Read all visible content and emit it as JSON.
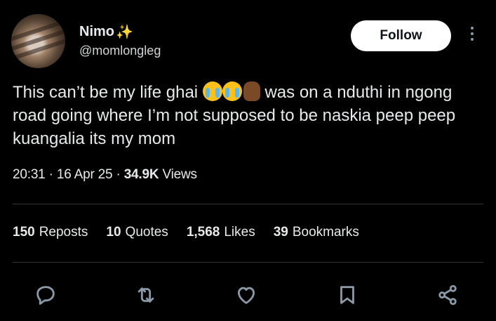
{
  "author": {
    "name": "Nimo",
    "name_emoji": "✨",
    "handle": "@momlongleg"
  },
  "header": {
    "follow_label": "Follow",
    "more_icon": "more-vertical-icon"
  },
  "tweet": {
    "text_part1": "This can’t be my life ghai ",
    "emojis": [
      "😭",
      "😭",
      "✋🏾"
    ],
    "text_part2": " was on a nduthi in ngong road going where I’m not supposed to be naskia peep peep kuangalia its my mom"
  },
  "meta": {
    "time": "20:31",
    "date": "16 Apr 25",
    "views_count": "34.9K",
    "views_label": "Views"
  },
  "stats": [
    {
      "count": "150",
      "label": "Reposts"
    },
    {
      "count": "10",
      "label": "Quotes"
    },
    {
      "count": "1,568",
      "label": "Likes"
    },
    {
      "count": "39",
      "label": "Bookmarks"
    }
  ],
  "actions": [
    "reply-icon",
    "repost-icon",
    "like-icon",
    "bookmark-icon",
    "share-icon"
  ],
  "colors": {
    "background": "#000000",
    "text": "#e7e9ea",
    "icon": "#8b98a5",
    "divider": "#2f3336",
    "follow_bg": "#ffffff"
  }
}
